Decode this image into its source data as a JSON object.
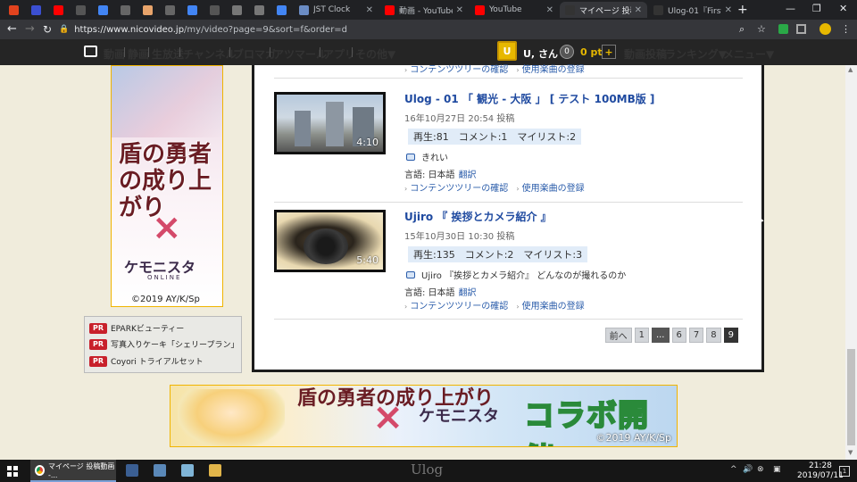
{
  "browser": {
    "tabs": [
      {
        "title": "",
        "favicon": "music-favicon",
        "color": "#e2431e"
      },
      {
        "title": "",
        "favicon": "d-favicon",
        "color": "#3b4fd1"
      },
      {
        "title": "",
        "favicon": "youtube-favicon",
        "color": "#ff0000"
      },
      {
        "title": "",
        "favicon": "page-favicon",
        "color": "#555555"
      },
      {
        "title": "",
        "favicon": "google-favicon",
        "color": "#4285f4"
      },
      {
        "title": "",
        "favicon": "page-favicon",
        "color": "#666666"
      },
      {
        "title": "",
        "favicon": "orange-favicon",
        "color": "#e8a46b"
      },
      {
        "title": "",
        "favicon": "page-favicon",
        "color": "#666666"
      },
      {
        "title": "",
        "favicon": "google-favicon",
        "color": "#4285f4"
      },
      {
        "title": "",
        "favicon": "page-favicon",
        "color": "#555555"
      },
      {
        "title": "",
        "favicon": "mail-favicon",
        "color": "#777777"
      },
      {
        "title": "",
        "favicon": "mail-favicon",
        "color": "#777777"
      },
      {
        "title": "",
        "favicon": "google-favicon",
        "color": "#4285f4"
      },
      {
        "title": "JST Clock",
        "favicon": "clock-favicon",
        "color": "#6b8cc4"
      },
      {
        "title": "動画 - YouTube",
        "favicon": "youtube-favicon",
        "color": "#ff0000"
      },
      {
        "title": "YouTube",
        "favicon": "youtube-favicon",
        "color": "#ff0000"
      },
      {
        "title": "マイページ 投稿動画",
        "favicon": "niconico-favicon",
        "color": "#333333",
        "active": true
      },
      {
        "title": "Ulog-01『First of",
        "favicon": "niconico-favicon",
        "color": "#333333"
      }
    ],
    "url_host": "https://www.nicovideo.jp",
    "url_path": "/my/video?page=9&sort=f&order=d"
  },
  "nav": {
    "items": [
      "動画",
      "静画",
      "生放送",
      "チャンネル",
      "ブロマガ",
      "アツマール",
      "アプリ",
      "その他▼"
    ],
    "user_avatar_letter": "U",
    "user_name": "U, さん",
    "points_icon": "0",
    "points": "0 pt",
    "points_add": "+",
    "right_items": [
      "動画投稿",
      "ランキング▼",
      "メニュー▼"
    ]
  },
  "ad_left": {
    "title": "盾の勇者の成り上がり",
    "cross": "×",
    "logo": "ケモニスタ",
    "logo_sub": "ONLINE",
    "copyright": "©2019 AY/K/Sp"
  },
  "pr": {
    "badge": "PR",
    "items": [
      "EPARKビューティー",
      "写真入りケーキ「シェリープラン」",
      "Coyori トライアルセット"
    ]
  },
  "partial_links": {
    "contents_tree": "コンテンツツリーの確認",
    "music": "使用楽曲の登録"
  },
  "videos": [
    {
      "title": "Ulog - 01 「 観光 - 大阪 」 [ テスト 100MB版 ]",
      "date": "16年10月27日 20:54 投稿",
      "duration": "4:10",
      "stats": "再生:81　コメント:1　マイリスト:2",
      "comment": "きれい",
      "lang_label": "言語: 日本語",
      "translate": "翻訳",
      "contents_tree": "コンテンツツリーの確認",
      "music": "使用楽曲の登録"
    },
    {
      "title": "Ujiro 『 挨拶とカメラ紹介 』",
      "date": "15年10月30日 10:30 投稿",
      "duration": "5:40",
      "stats": "再生:135　コメント:2　マイリスト:3",
      "comment": "Ujiro 『挨拶とカメラ紹介』 どんなのが撮れるのか",
      "lang_label": "言語: 日本語",
      "translate": "翻訳",
      "contents_tree": "コンテンツツリーの確認",
      "music": "使用楽曲の登録"
    }
  ],
  "pager": {
    "prev": "前へ",
    "pages": [
      "1",
      "...",
      "6",
      "7",
      "8",
      "9"
    ],
    "current": "9"
  },
  "banner": {
    "title": "盾の勇者の成り上がり",
    "cross": "×",
    "logo": "ケモニスタ",
    "collab": "コラボ開催!",
    "copyright": "©2019 AY/K/Sp"
  },
  "taskbar": {
    "chrome_label": "マイページ 投稿動画 -...",
    "watermark": "Ulog",
    "time": "21:28",
    "date": "2019/07/11",
    "notification_count": "1"
  }
}
